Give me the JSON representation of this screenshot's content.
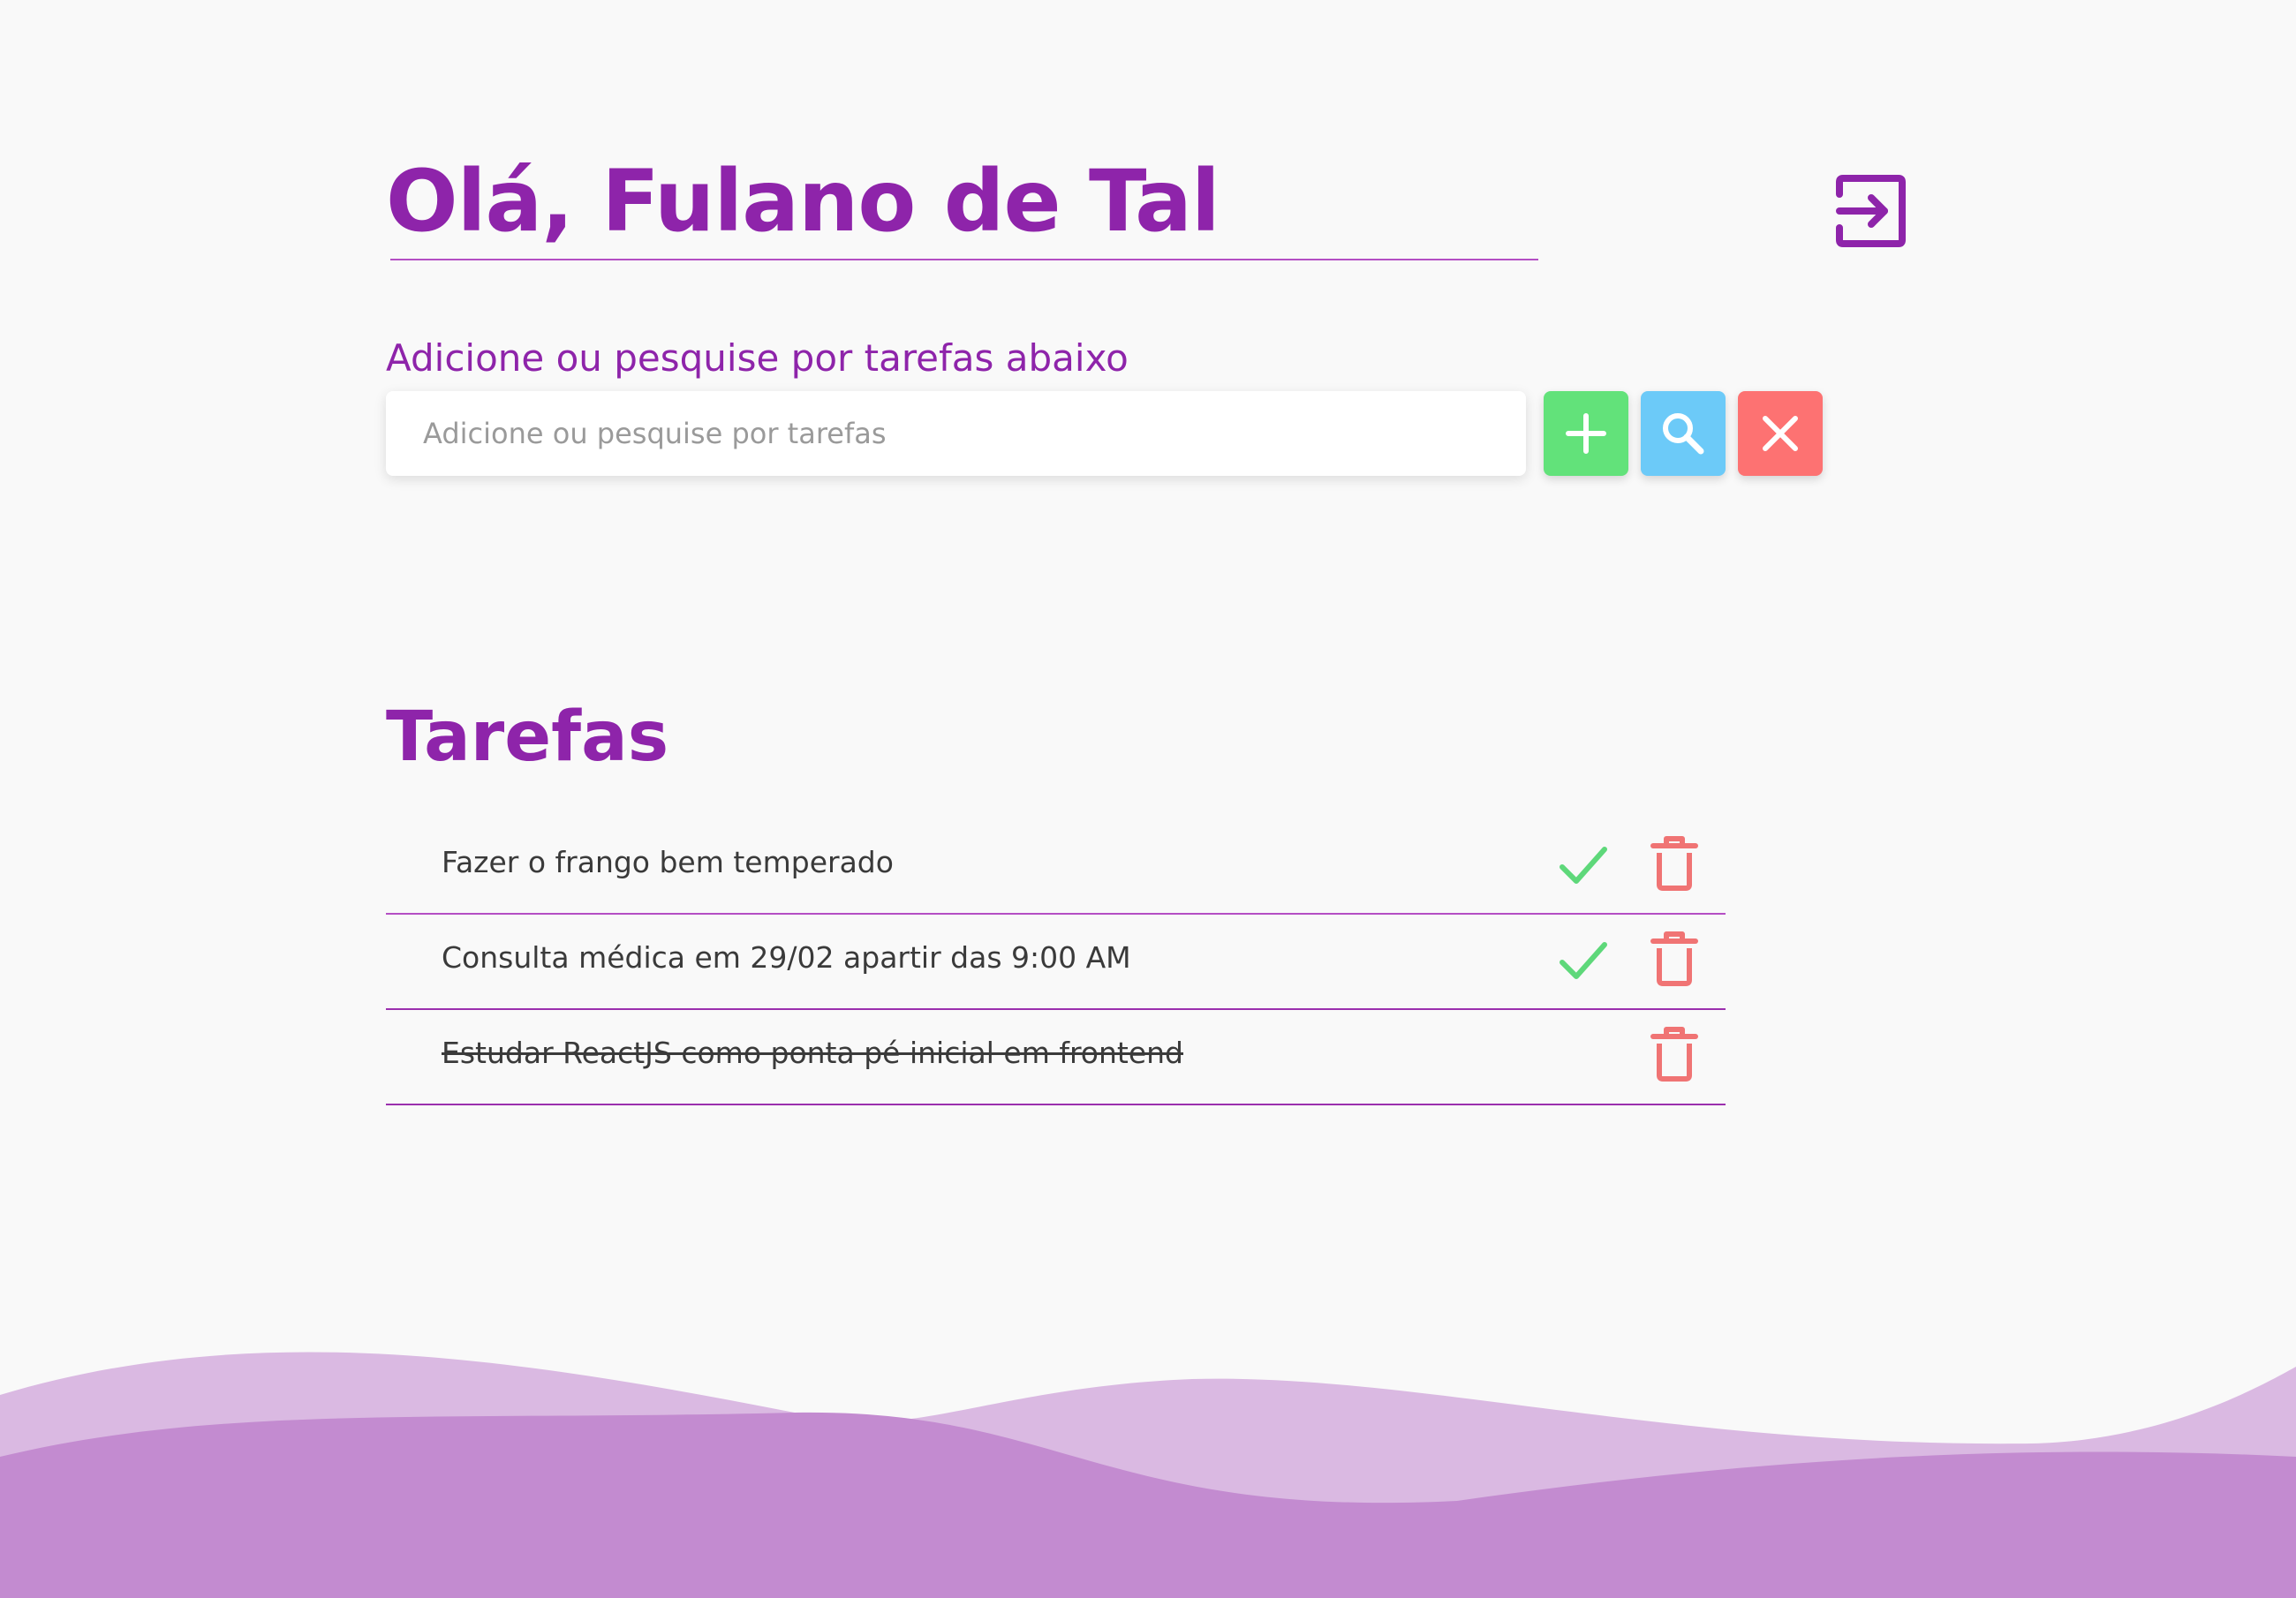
{
  "header": {
    "greeting": "Olá, Fulano de Tal",
    "logout_icon": "logout-icon"
  },
  "form": {
    "subtitle": "Adicione ou pesquise por tarefas abaixo",
    "placeholder": "Adicione ou pesquise por tarefas",
    "value": "",
    "buttons": {
      "add": "plus-icon",
      "search": "search-icon",
      "clear": "close-icon"
    }
  },
  "tasks": {
    "title": "Tarefas",
    "items": [
      {
        "text": "Fazer o frango bem temperado",
        "completed": false
      },
      {
        "text": "Consulta médica em 29/02 apartir das 9:00 AM",
        "completed": false
      },
      {
        "text": "Estudar ReactJS como ponta pé inicial em frontend",
        "completed": true
      }
    ]
  },
  "colors": {
    "primary": "#8e24aa",
    "add": "#62e27a",
    "search": "#6ccaf8",
    "clear": "#fd7272",
    "check": "#5ed87a",
    "trash": "#f07474",
    "wave_light": "#dab9e2",
    "wave_dark": "#c38bd0"
  }
}
